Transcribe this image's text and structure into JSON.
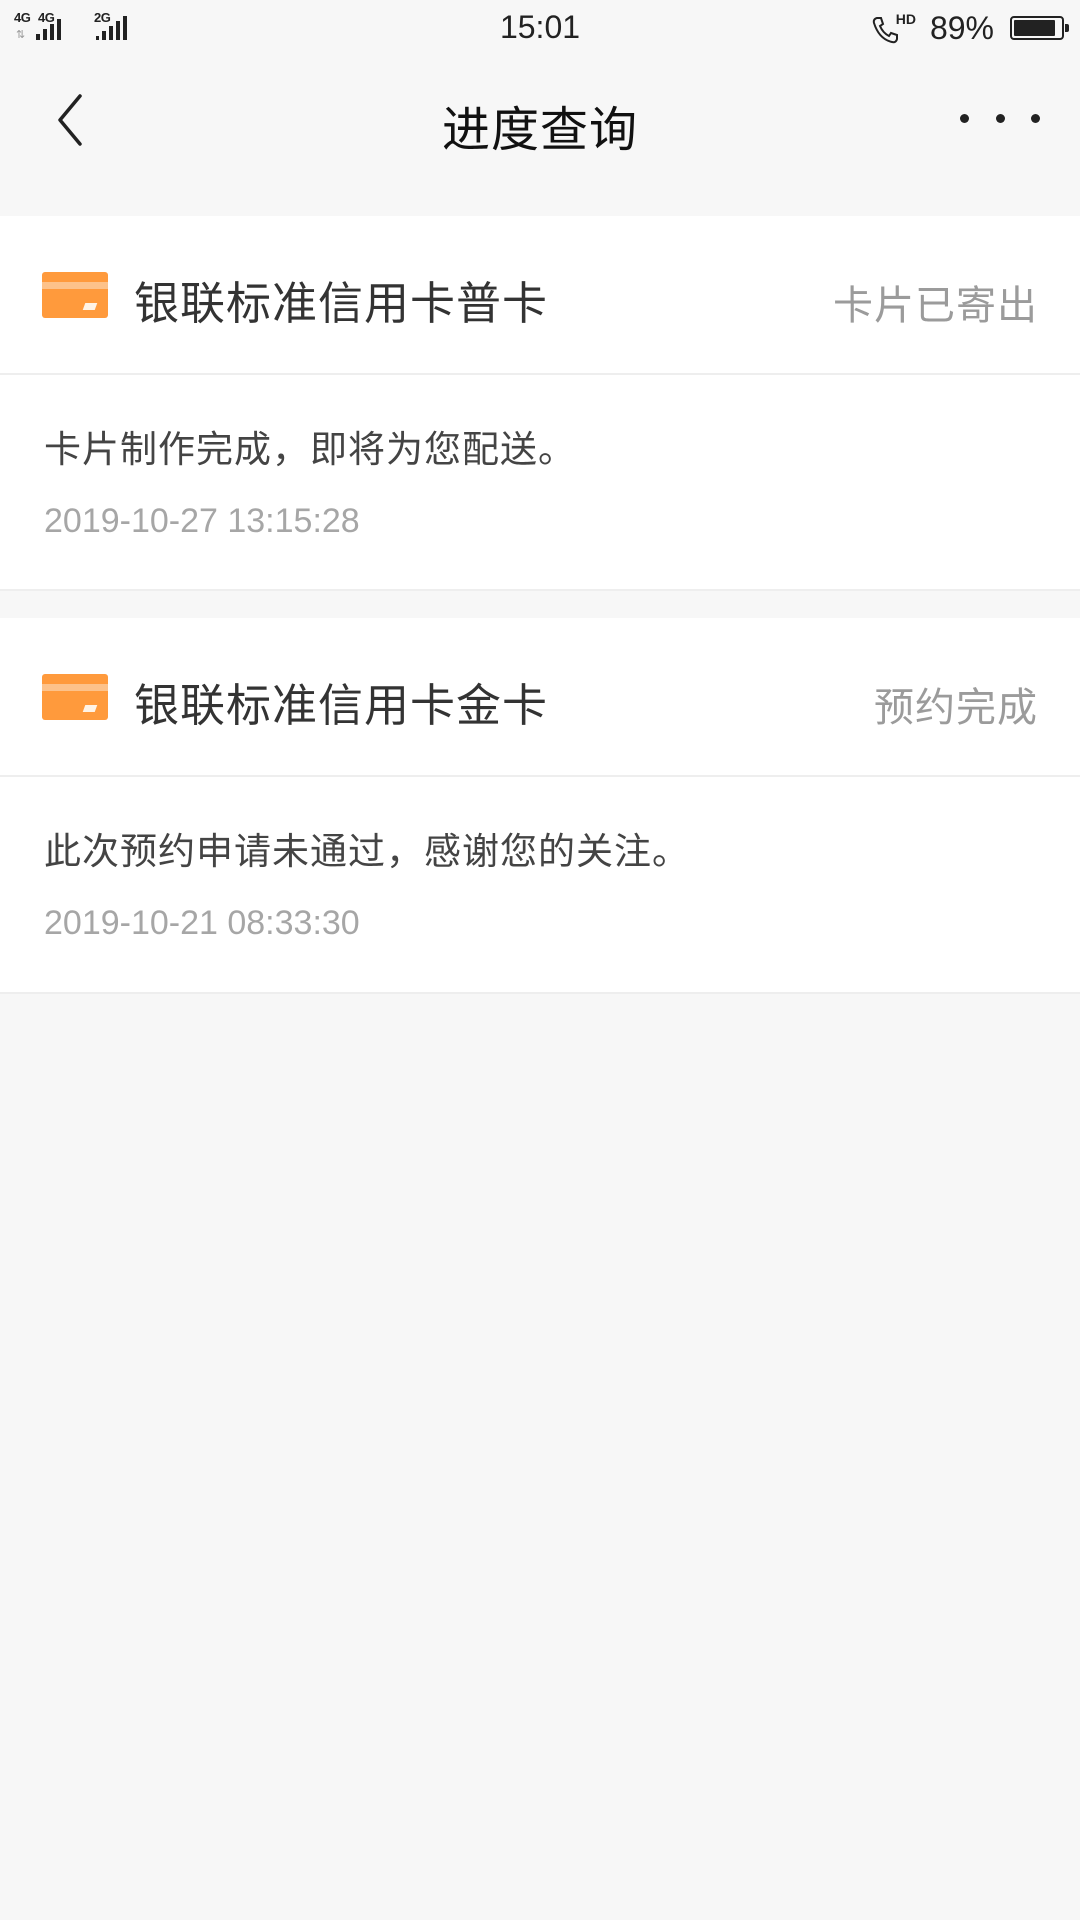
{
  "status_bar": {
    "sim1_label": "4G",
    "sim1_sub_label": "4G",
    "sim2_label": "2G",
    "time": "15:01",
    "hd_label": "HD",
    "battery_percent": "89%",
    "battery_level": 0.89
  },
  "nav": {
    "title": "进度查询",
    "back_icon": "chevron-left-icon",
    "more_icon": "more-dots-icon"
  },
  "colors": {
    "card_icon": "#ff9a3c",
    "status_text": "#9b9b9b",
    "time_text": "#a6a6a6"
  },
  "applications": [
    {
      "card_name": "银联标准信用卡普卡",
      "status": "卡片已寄出",
      "message": "卡片制作完成，即将为您配送。",
      "time": "2019-10-27 13:15:28",
      "icon": "credit-card-icon"
    },
    {
      "card_name": "银联标准信用卡金卡",
      "status": "预约完成",
      "message": "此次预约申请未通过，感谢您的关注。",
      "time": "2019-10-21 08:33:30",
      "icon": "credit-card-icon"
    }
  ]
}
